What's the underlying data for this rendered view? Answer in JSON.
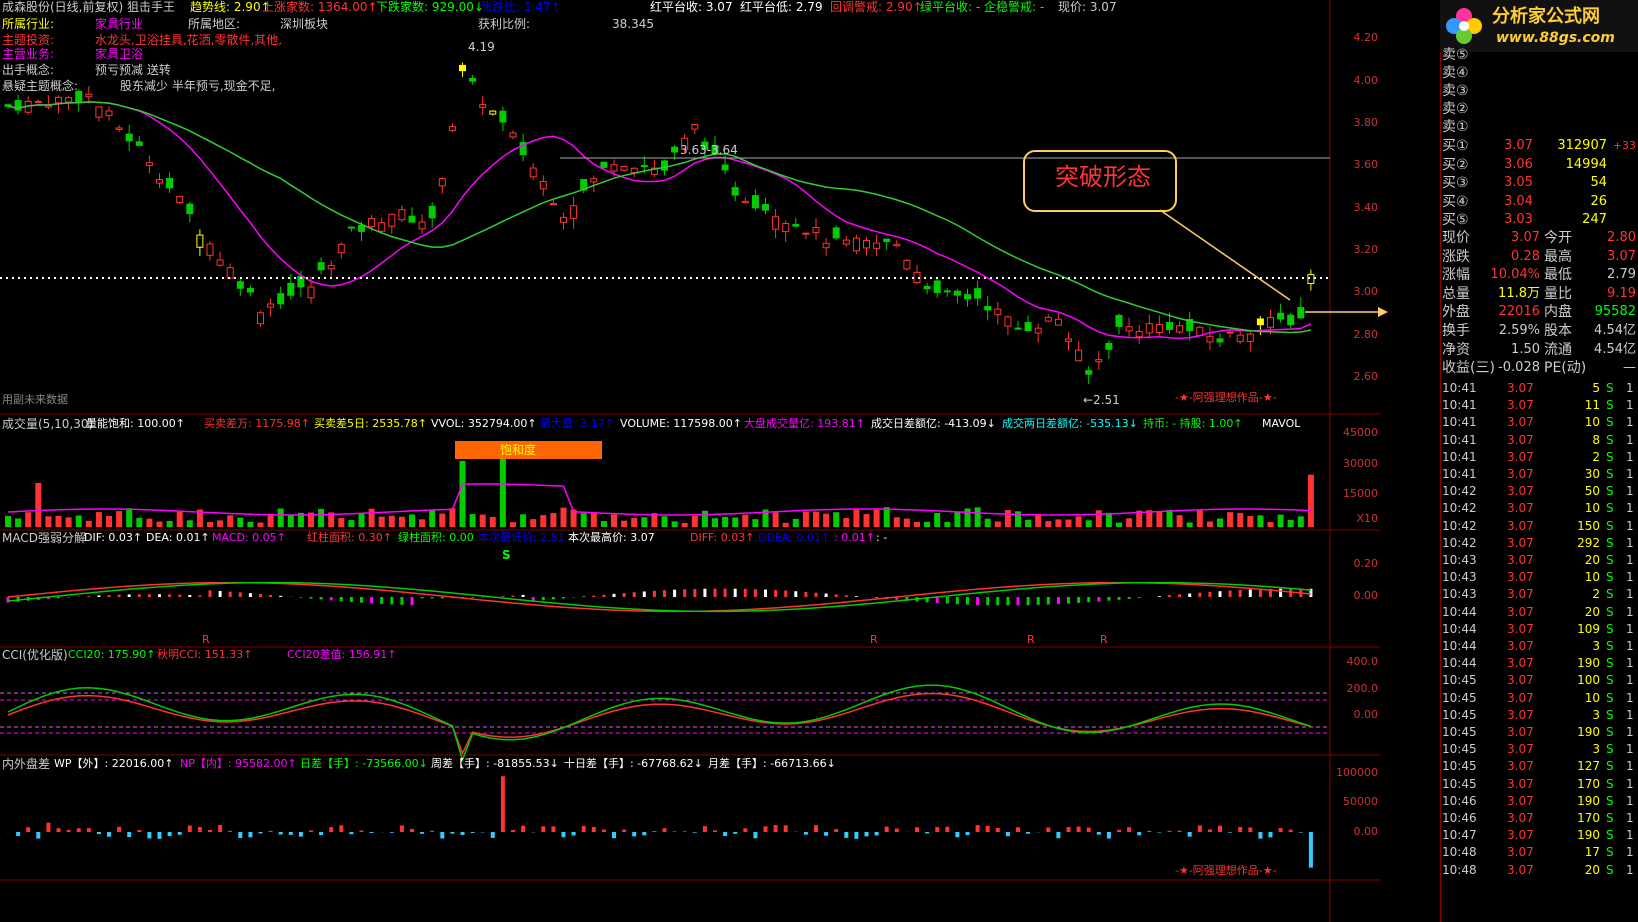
{
  "header": {
    "title": "成森股份(日线,前复权) 狙击手王",
    "items": [
      {
        "text": "趋势线: 2.90↑",
        "color": "#ff0"
      },
      {
        "text": "上涨家数: 1364.00↑",
        "color": "#f33"
      },
      {
        "text": "下跌家数: 929.00↓",
        "color": "#0f0"
      },
      {
        "text": "涨跌比: 1.47↑",
        "color": "#00f"
      },
      {
        "text": "红平台收: 3.07",
        "color": "#fff"
      },
      {
        "text": "红平台低: 2.79",
        "color": "#fff"
      },
      {
        "text": "回调警戒: 2.90↑",
        "color": "#f33"
      },
      {
        "text": "绿平台收: - 企稳警戒: -",
        "color": "#0f0"
      },
      {
        "text": "现价: 3.07",
        "color": "#ccc"
      }
    ]
  },
  "info": {
    "industry_label": "所属行业:",
    "industry": "家具行业",
    "region_label": "所属地区:",
    "region": "深圳板块",
    "profit_label": "获利比例:",
    "profit": "38.345",
    "theme_label": "主题投资:",
    "theme": "水龙头,卫浴挂具,花洒,零散件,其他,",
    "business_label": "主营业务:",
    "business": "家具卫浴",
    "concept_label": "出手概念:",
    "concept": "预亏预减 送转",
    "hot_label": "悬疑主题概念:",
    "hot": "股东减少 半年预亏,现金不足,"
  },
  "annotations": {
    "high": "4.19",
    "low": "←2.51",
    "range": "3.63-3.64",
    "breakout": "突破形态",
    "watermark": "用副未来数据",
    "author": "-★-阿强理想作品-★-",
    "author2": "-★-阿强理想作品-★-",
    "saturation": "饱和度"
  },
  "price_axis": [
    "4.20",
    "4.00",
    "3.80",
    "3.60",
    "3.40",
    "3.20",
    "3.00",
    "2.80",
    "2.60"
  ],
  "volume_panel": {
    "title": "成交量(5,10,30)",
    "items": [
      {
        "text": "量能饱和: 100.00↑",
        "color": "#fff"
      },
      {
        "text": "买卖差万: 1175.98↑",
        "color": "#f33"
      },
      {
        "text": "买卖差5日: 2535.78↑",
        "color": "#ff0"
      },
      {
        "text": "VVOL: 352794.00↑",
        "color": "#fff"
      },
      {
        "text": "最大量: 3.17↑",
        "color": "#00f"
      },
      {
        "text": "VOLUME: 117598.00↑",
        "color": "#fff"
      },
      {
        "text": "大盘成交量亿: 193.81↑",
        "color": "#f0f"
      },
      {
        "text": "成交日差额亿: -413.09↓",
        "color": "#fff"
      },
      {
        "text": "成交两日差额亿: -535.13↓",
        "color": "#0ff"
      },
      {
        "text": "持币: - 持股: 1.00↑",
        "color": "#0f0"
      },
      {
        "text": "MAVOL",
        "color": "#fff"
      }
    ],
    "axis": [
      "45000",
      "30000",
      "15000",
      "X10"
    ]
  },
  "macd_panel": {
    "title": "MACD强弱分解",
    "items": [
      {
        "text": "DIF: 0.03↑",
        "color": "#fff"
      },
      {
        "text": "DEA: 0.01↑",
        "color": "#fff"
      },
      {
        "text": "MACD: 0.05↑",
        "color": "#f0f"
      },
      {
        "text": "红柱面积: 0.30↑",
        "color": "#f33"
      },
      {
        "text": "绿柱面积: 0.00",
        "color": "#0f0"
      },
      {
        "text": "本次最低价: 2.51",
        "color": "#00f"
      },
      {
        "text": "本次最高价: 3.07",
        "color": "#fff"
      },
      {
        "text": "DIFF: 0.03↑",
        "color": "#f33"
      },
      {
        "text": "DDEA: 0.01↑",
        "color": "#00f"
      },
      {
        "text": ": 0.01↑",
        "color": "#f0f"
      },
      {
        "text": ": -",
        "color": "#fff"
      }
    ],
    "axis": [
      "0.20",
      "0.00"
    ],
    "marks": [
      "S",
      "R",
      "R",
      "R",
      "R"
    ]
  },
  "cci_panel": {
    "title": "CCI(优化版)",
    "items": [
      {
        "text": "CCI20: 175.90↑",
        "color": "#0f0"
      },
      {
        "text": "秋明CCI: 151.33↑",
        "color": "#f33"
      },
      {
        "text": "CCI20差值: 156.91↑",
        "color": "#f0f"
      }
    ],
    "axis": [
      "400.0",
      "200.0",
      "0.00"
    ]
  },
  "flow_panel": {
    "title": "内外盘差",
    "items": [
      {
        "text": "WP【外】: 22016.00↑",
        "color": "#fff"
      },
      {
        "text": "NP【内】: 95582.00↑",
        "color": "#f0f"
      },
      {
        "text": "日差【手】: -73566.00↓",
        "color": "#0f0"
      },
      {
        "text": "周差【手】: -81855.53↓",
        "color": "#fff"
      },
      {
        "text": "十日差【手】: -67768.62↓",
        "color": "#fff"
      },
      {
        "text": "月差【手】: -66713.66↓",
        "color": "#fff"
      }
    ],
    "axis": [
      "100000",
      "50000",
      "0.00"
    ]
  },
  "logo": {
    "name": "分析家公式网",
    "url": "www.88gs.com"
  },
  "sell_levels": [
    {
      "label": "卖⑤",
      "price": "",
      "vol": ""
    },
    {
      "label": "卖④",
      "price": "",
      "vol": ""
    },
    {
      "label": "卖③",
      "price": "",
      "vol": ""
    },
    {
      "label": "卖②",
      "price": "",
      "vol": ""
    },
    {
      "label": "卖①",
      "price": "",
      "vol": ""
    }
  ],
  "buy_levels": [
    {
      "label": "买①",
      "price": "3.07",
      "vol": "312907",
      "chg": "+33"
    },
    {
      "label": "买②",
      "price": "3.06",
      "vol": "14994",
      "chg": ""
    },
    {
      "label": "买③",
      "price": "3.05",
      "vol": "54",
      "chg": ""
    },
    {
      "label": "买④",
      "price": "3.04",
      "vol": "26",
      "chg": ""
    },
    {
      "label": "买⑤",
      "price": "3.03",
      "vol": "247",
      "chg": ""
    }
  ],
  "stats": [
    {
      "k1": "现价",
      "v1": "3.07",
      "k2": "今开",
      "v2": "2.80",
      "c1": "#f33",
      "c2": "#f33"
    },
    {
      "k1": "涨跌",
      "v1": "0.28",
      "k2": "最高",
      "v2": "3.07",
      "c1": "#f33",
      "c2": "#f33"
    },
    {
      "k1": "涨幅",
      "v1": "10.04%",
      "k2": "最低",
      "v2": "2.79",
      "c1": "#f33",
      "c2": "#ccc"
    },
    {
      "k1": "总量",
      "v1": "11.8万",
      "k2": "量比",
      "v2": "9.19",
      "c1": "#ff0",
      "c2": "#f33"
    },
    {
      "k1": "外盘",
      "v1": "22016",
      "k2": "内盘",
      "v2": "95582",
      "c1": "#f33",
      "c2": "#0f0"
    },
    {
      "k1": "换手",
      "v1": "2.59%",
      "k2": "股本",
      "v2": "4.54亿",
      "c1": "#ccc",
      "c2": "#ccc"
    },
    {
      "k1": "净资",
      "v1": "1.50",
      "k2": "流通",
      "v2": "4.54亿",
      "c1": "#ccc",
      "c2": "#ccc"
    },
    {
      "k1": "收益(三)",
      "v1": "-0.028",
      "k2": "PE(动)",
      "v2": "—",
      "c1": "#ccc",
      "c2": "#ccc"
    }
  ],
  "ticks": [
    {
      "time": "10:41",
      "price": "3.07",
      "vol": "5",
      "bs": "S",
      "n": "1"
    },
    {
      "time": "10:41",
      "price": "3.07",
      "vol": "11",
      "bs": "S",
      "n": "1"
    },
    {
      "time": "10:41",
      "price": "3.07",
      "vol": "10",
      "bs": "S",
      "n": "1"
    },
    {
      "time": "10:41",
      "price": "3.07",
      "vol": "8",
      "bs": "S",
      "n": "1"
    },
    {
      "time": "10:41",
      "price": "3.07",
      "vol": "2",
      "bs": "S",
      "n": "1"
    },
    {
      "time": "10:41",
      "price": "3.07",
      "vol": "30",
      "bs": "S",
      "n": "1"
    },
    {
      "time": "10:42",
      "price": "3.07",
      "vol": "50",
      "bs": "S",
      "n": "1"
    },
    {
      "time": "10:42",
      "price": "3.07",
      "vol": "10",
      "bs": "S",
      "n": "1"
    },
    {
      "time": "10:42",
      "price": "3.07",
      "vol": "150",
      "bs": "S",
      "n": "1"
    },
    {
      "time": "10:42",
      "price": "3.07",
      "vol": "292",
      "bs": "S",
      "n": "1"
    },
    {
      "time": "10:43",
      "price": "3.07",
      "vol": "20",
      "bs": "S",
      "n": "1"
    },
    {
      "time": "10:43",
      "price": "3.07",
      "vol": "10",
      "bs": "S",
      "n": "1"
    },
    {
      "time": "10:43",
      "price": "3.07",
      "vol": "2",
      "bs": "S",
      "n": "1"
    },
    {
      "time": "10:44",
      "price": "3.07",
      "vol": "20",
      "bs": "S",
      "n": "1"
    },
    {
      "time": "10:44",
      "price": "3.07",
      "vol": "109",
      "bs": "S",
      "n": "1"
    },
    {
      "time": "10:44",
      "price": "3.07",
      "vol": "3",
      "bs": "S",
      "n": "1"
    },
    {
      "time": "10:44",
      "price": "3.07",
      "vol": "190",
      "bs": "S",
      "n": "1"
    },
    {
      "time": "10:45",
      "price": "3.07",
      "vol": "100",
      "bs": "S",
      "n": "1"
    },
    {
      "time": "10:45",
      "price": "3.07",
      "vol": "10",
      "bs": "S",
      "n": "1"
    },
    {
      "time": "10:45",
      "price": "3.07",
      "vol": "3",
      "bs": "S",
      "n": "1"
    },
    {
      "time": "10:45",
      "price": "3.07",
      "vol": "190",
      "bs": "S",
      "n": "1"
    },
    {
      "time": "10:45",
      "price": "3.07",
      "vol": "3",
      "bs": "S",
      "n": "1"
    },
    {
      "time": "10:45",
      "price": "3.07",
      "vol": "127",
      "bs": "S",
      "n": "1"
    },
    {
      "time": "10:45",
      "price": "3.07",
      "vol": "170",
      "bs": "S",
      "n": "1"
    },
    {
      "time": "10:46",
      "price": "3.07",
      "vol": "190",
      "bs": "S",
      "n": "1"
    },
    {
      "time": "10:46",
      "price": "3.07",
      "vol": "170",
      "bs": "S",
      "n": "1"
    },
    {
      "time": "10:47",
      "price": "3.07",
      "vol": "190",
      "bs": "S",
      "n": "1"
    },
    {
      "time": "10:48",
      "price": "3.07",
      "vol": "17",
      "bs": "S",
      "n": "1"
    },
    {
      "time": "10:48",
      "price": "3.07",
      "vol": "20",
      "bs": "S",
      "n": "1"
    }
  ]
}
